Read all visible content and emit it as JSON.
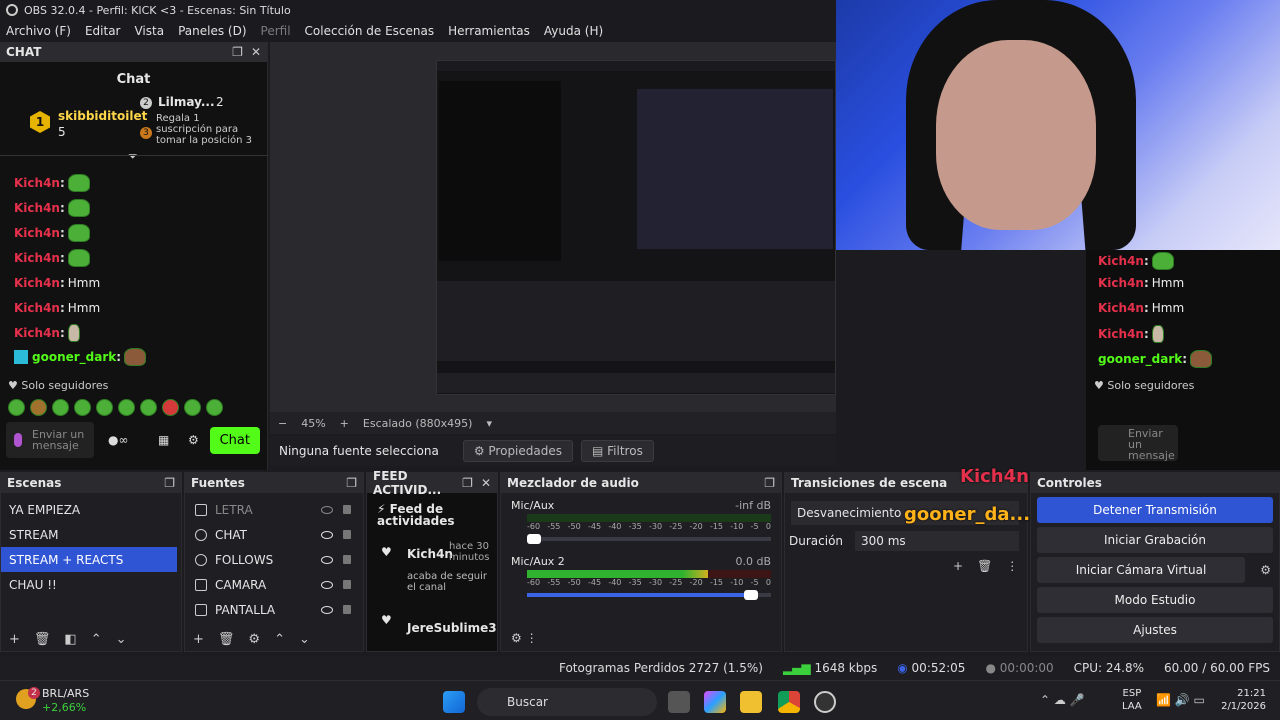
{
  "window": {
    "title": "OBS 32.0.4 - Perfil: KICK <3 - Escenas: Sin Título"
  },
  "menu": [
    "Archivo (F)",
    "Editar",
    "Vista",
    "Paneles (D)",
    "Perfil",
    "Colección de Escenas",
    "Herramientas",
    "Ayuda (H)"
  ],
  "chat": {
    "dock_title": "CHAT",
    "title": "Chat",
    "pinned": {
      "rank1": "1",
      "user1": "skibbiditoilet",
      "count1": "5",
      "rank2": "2",
      "user2": "Lilmay...",
      "count2": "2",
      "rank3": "3",
      "gift_text": "Regala 1 suscripción para tomar la posición 3"
    },
    "messages": [
      {
        "user": "Kich4n",
        "text": ""
      },
      {
        "user": "Kich4n",
        "text": ""
      },
      {
        "user": "Kich4n",
        "text": ""
      },
      {
        "user": "Kich4n",
        "text": ""
      },
      {
        "user": "Kich4n",
        "text": "Hmm"
      },
      {
        "user": "Kich4n",
        "text": "Hmm"
      },
      {
        "user": "Kich4n",
        "text": ""
      },
      {
        "user": "gooner_dark",
        "text": ""
      }
    ],
    "mode": "Solo seguidores",
    "input_placeholder": "Enviar un mensaje",
    "send": "Chat"
  },
  "right_chat": {
    "messages": [
      {
        "user": "Kich4n",
        "text": ""
      },
      {
        "user": "Kich4n",
        "text": "Hmm"
      },
      {
        "user": "Kich4n",
        "text": "Hmm"
      },
      {
        "user": "Kich4n",
        "text": ""
      },
      {
        "user": "gooner_dark",
        "text": ""
      }
    ],
    "mode": "Solo seguidores",
    "input_placeholder": "Enviar un mensaje"
  },
  "preview": {
    "zoom": "45%",
    "scale": "Escalado (880x495)",
    "no_source": "Ninguna fuente selecciona",
    "properties": "Propiedades",
    "filters": "Filtros"
  },
  "scenes": {
    "title": "Escenas",
    "items": [
      "YA EMPIEZA",
      "STREAM",
      "STREAM + REACTS",
      "CHAU !!"
    ],
    "selected": 2
  },
  "sources": {
    "title": "Fuentes",
    "items": [
      "LETRA",
      "CHAT",
      "FOLLOWS",
      "CAMARA",
      "PANTALLA"
    ]
  },
  "feed": {
    "title": "FEED ACTIVID...",
    "heading": "Feed de actividades",
    "item1_user": "Kich4n",
    "item1_time": "hace 30 minutos",
    "item1_action": "acaba de seguir el canal",
    "item2_user": "JereSublime3"
  },
  "mixer": {
    "title": "Mezclador de audio",
    "ch1": {
      "name": "Mic/Aux",
      "db": "-inf dB",
      "level": 0
    },
    "ch2": {
      "name": "Mic/Aux 2",
      "db": "0.0 dB",
      "level": 0.92
    },
    "ticks": [
      "-60",
      "-55",
      "-50",
      "-45",
      "-40",
      "-35",
      "-30",
      "-25",
      "-20",
      "-15",
      "-10",
      "-5",
      "0"
    ]
  },
  "transitions": {
    "title": "Transiciones de escena",
    "type": "Desvanecimiento",
    "duration_label": "Duración",
    "duration": "300 ms"
  },
  "controls": {
    "title": "Controles",
    "stop": "Detener Transmisión",
    "record": "Iniciar Grabación",
    "vcam": "Iniciar Cámara Virtual",
    "studio": "Modo Estudio",
    "settings": "Ajustes"
  },
  "overlay": {
    "name1": "Kich4n",
    "name2": "gooner_da..."
  },
  "status": {
    "dropped": "Fotogramas Perdidos 2727 (1.5%)",
    "kbps": "1648 kbps",
    "stream_time": "00:52:05",
    "rec_time": "00:00:00",
    "cpu": "CPU: 24.8%",
    "fps": "60.00 / 60.00 FPS"
  },
  "taskbar": {
    "ticker": "BRL/ARS",
    "change": "+2,66%",
    "badge": "2",
    "search": "Buscar",
    "lang1": "ESP",
    "lang2": "LAA",
    "time": "21:21",
    "date": "2/1/2026"
  },
  "colors": {
    "accent": "#2f55d4",
    "kick_green": "#53fc18",
    "chat_user": "#e5304b",
    "gift_gold": "#e6b400"
  }
}
